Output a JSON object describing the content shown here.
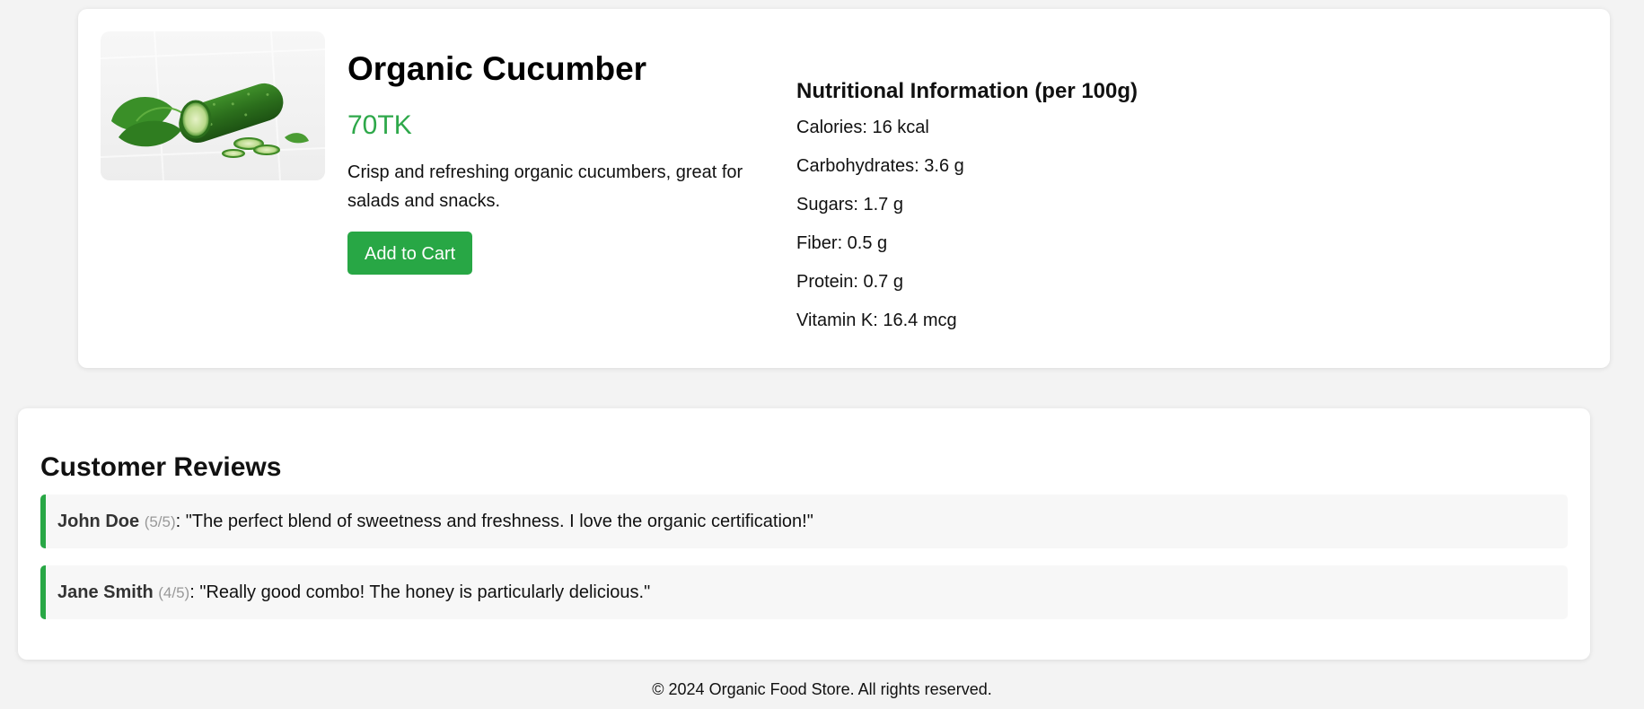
{
  "product": {
    "name": "Organic Cucumber",
    "price": "70TK",
    "description": "Crisp and refreshing organic cucumbers, great for salads and snacks.",
    "add_to_cart_label": "Add to Cart",
    "image_icon": "cucumber-image"
  },
  "nutrition": {
    "title": "Nutritional Information (per 100g)",
    "items": [
      "Calories: 16 kcal",
      "Carbohydrates: 3.6 g",
      "Sugars: 1.7 g",
      "Fiber: 0.5 g",
      "Protein: 0.7 g",
      "Vitamin K: 16.4 mcg"
    ]
  },
  "reviews": {
    "title": "Customer Reviews",
    "items": [
      {
        "name": "John Doe",
        "rating": "(5/5)",
        "text": ": \"The perfect blend of sweetness and freshness. I love the organic certification!\""
      },
      {
        "name": "Jane Smith",
        "rating": "(4/5)",
        "text": ": \"Really good combo! The honey is particularly delicious.\""
      }
    ]
  },
  "footer": {
    "text": "© 2024 Organic Food Store. All rights reserved."
  },
  "colors": {
    "accent_green": "#28a745",
    "price_green": "#2ea84a",
    "page_background": "#f3f3f3",
    "review_background": "#f7f7f7"
  }
}
